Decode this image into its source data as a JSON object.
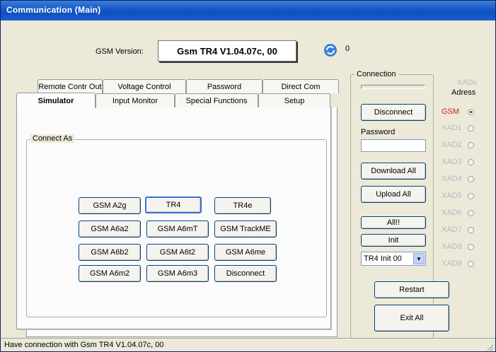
{
  "window": {
    "title": "Communication (Main)"
  },
  "header": {
    "gsm_version_label": "GSM Version:",
    "gsm_version_value": "Gsm TR4 V1.04.07c, 00",
    "counter": "0"
  },
  "tabs": {
    "row_back": [
      "Remote Contr Out",
      "Voltage Control",
      "Password",
      "Direct Com"
    ],
    "row_front": [
      "Simulator",
      "Input Monitor",
      "Special Functions",
      "Setup"
    ]
  },
  "simulator": {
    "group_label": "Connect As",
    "buttons": [
      "GSM A2g",
      "TR4",
      "TR4e",
      "GSM A6a2",
      "GSM A6mT",
      "GSM TrackME",
      "GSM A6b2",
      "GSM A6t2",
      "GSM A6me",
      "GSM A6m2",
      "GSM A6m3",
      "Disconnect"
    ]
  },
  "connection": {
    "group_label": "Connection",
    "disconnect_label": "Disconnect",
    "password_label": "Password",
    "password_value": "",
    "download_all_label": "Download All",
    "upload_all_label": "Upload All",
    "all_label": "All!!",
    "init_label": "Init",
    "init_select_value": "TR4 Init 00"
  },
  "xadx": {
    "title": "XADx",
    "subtitle": "Adress",
    "items": [
      "GSM",
      "XAD1",
      "XAD2",
      "XAD3",
      "XAD4",
      "XAD5",
      "XAD6",
      "XAD7",
      "XAD8",
      "XAD9"
    ],
    "selected": "GSM"
  },
  "actions": {
    "restart_label": "Restart",
    "exit_all_label": "Exit All"
  },
  "status": {
    "text": "Have connection with Gsm TR4 V1.04.07c, 00"
  },
  "colors": {
    "title_bar": "#1458c8",
    "selected_radio_label": "#d21f1f",
    "disabled_text": "#b8b8c4"
  }
}
